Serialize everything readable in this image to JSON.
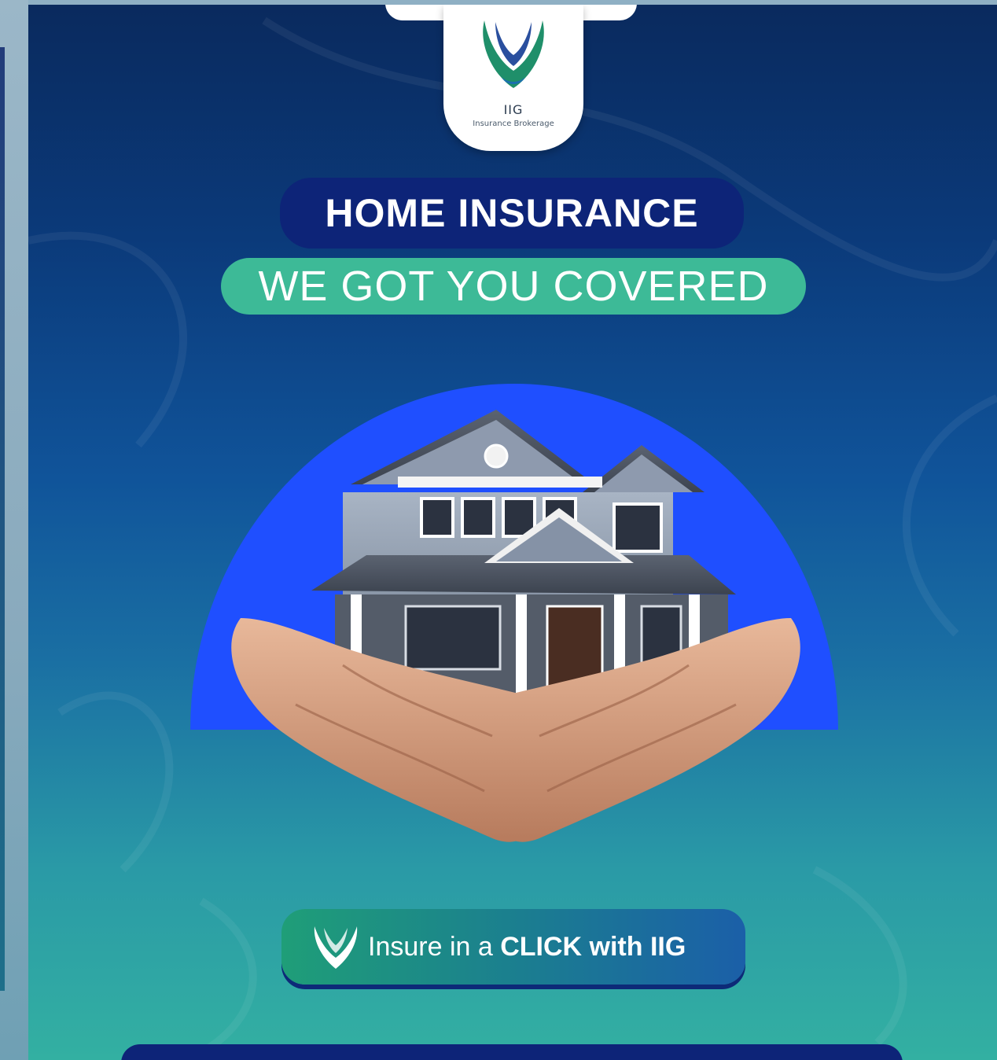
{
  "logo": {
    "name": "IIG",
    "subtitle": "Insurance Brokerage",
    "icon": "iig-v-shield-logo"
  },
  "headline": "HOME INSURANCE",
  "tagline": "WE GOT YOU COVERED",
  "hero": {
    "illustration": "hands-holding-house-image"
  },
  "cta": {
    "text_prefix": "Insure in a ",
    "text_bold": "CLICK with IIG",
    "icon": "iig-v-icon"
  },
  "colors": {
    "navy": "#0d2478",
    "green": "#3dba97",
    "accent_blue": "#1f4fff",
    "background_top": "#0a2a5e",
    "background_bottom": "#33b0a2"
  }
}
